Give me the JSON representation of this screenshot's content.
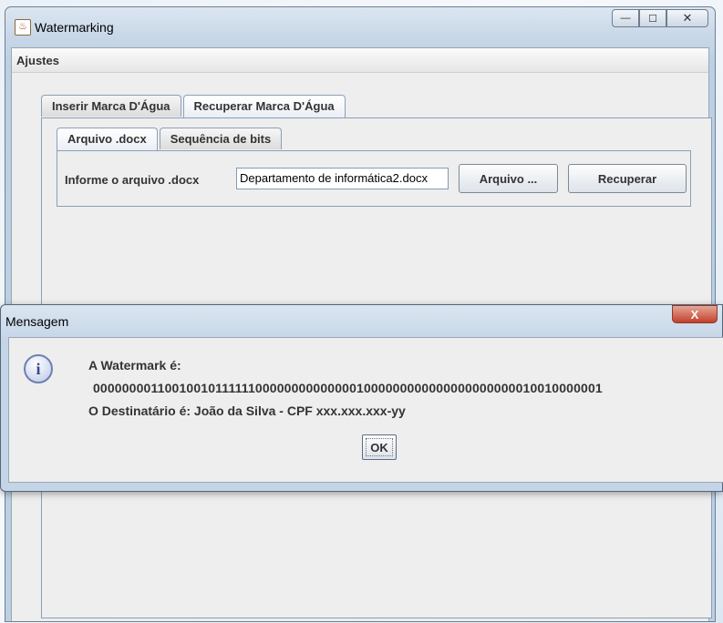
{
  "window": {
    "title": "Watermarking",
    "controls": {
      "minimize": "—",
      "maximize": "☐",
      "close": "✕"
    }
  },
  "menu": {
    "items": [
      "Ajustes"
    ]
  },
  "outer_tabs": [
    {
      "label": "Inserir Marca D'Água",
      "active": false
    },
    {
      "label": "Recuperar Marca D'Água",
      "active": true
    }
  ],
  "inner_tabs": [
    {
      "label": "Arquivo .docx",
      "active": true
    },
    {
      "label": "Sequência de bits",
      "active": false
    }
  ],
  "form": {
    "file_label": "Informe o arquivo .docx",
    "file_value": "Departamento de informática2.docx",
    "browse_button": "Arquivo ...",
    "recover_button": "Recuperar"
  },
  "dialog": {
    "title": "Mensagem",
    "close_glyph": "X",
    "icon": "info-icon",
    "line1": "A Watermark é:",
    "line2": "00000000110010010111111000000000000001000000000000000000000010010000001",
    "line3": "O Destinatário é: João da Silva - CPF xxx.xxx.xxx-yy",
    "ok_button": "OK"
  }
}
